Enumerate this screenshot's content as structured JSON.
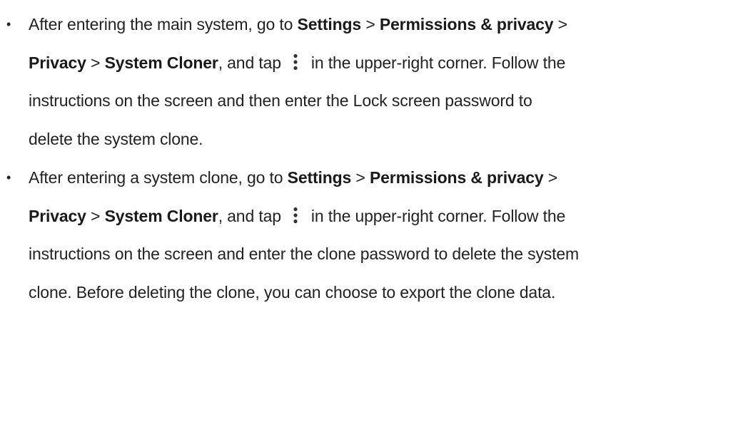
{
  "items": [
    {
      "line1": {
        "t1": "After entering the main system, go to ",
        "b1": "Settings",
        "t2": " > ",
        "b2": "Permissions & privacy",
        "t3": " >"
      },
      "line2": {
        "b1": "Privacy",
        "t1": " > ",
        "b2": "System Cloner",
        "t2": ", and tap",
        "icon": "more-vertical-icon",
        "t3": "in the upper-right corner. Follow the"
      },
      "line3": "instructions on the screen and then enter the Lock screen password to",
      "line4": "delete the system clone."
    },
    {
      "line1": {
        "t1": "After entering a system clone, go to ",
        "b1": "Settings",
        "t2": " > ",
        "b2": "Permissions & privacy",
        "t3": " >"
      },
      "line2": {
        "b1": "Privacy",
        "t1": " > ",
        "b2": "System Cloner",
        "t2": ", and tap",
        "icon": "more-vertical-icon",
        "t3": "in the upper-right corner. Follow the"
      },
      "line3": "instructions on the screen and enter the clone password to delete the system",
      "line4": "clone. Before deleting the clone, you can choose to export the clone data."
    }
  ],
  "bullet_glyph": "•"
}
